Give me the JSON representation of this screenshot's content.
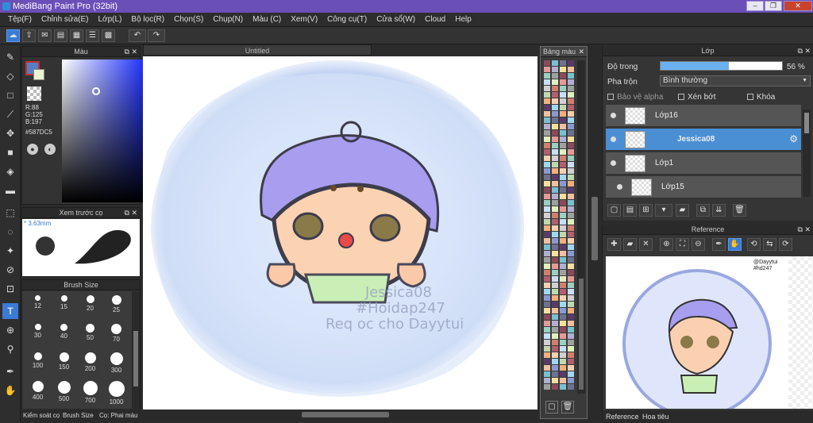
{
  "window": {
    "title": "MediBang Paint Pro (32bit)"
  },
  "menu": [
    "Tệp(F)",
    "Chỉnh sửa(E)",
    "Lớp(L)",
    "Bộ lọc(R)",
    "Chọn(S)",
    "Chụp(N)",
    "Màu (C)",
    "Xem(V)",
    "Công cụ(T)",
    "Cửa sổ(W)",
    "Cloud",
    "Help"
  ],
  "color_panel": {
    "title": "Màu",
    "r": "R:88",
    "g": "G:125",
    "b": "B:197",
    "hex": "#587DC5",
    "color": "#587dc5"
  },
  "preview_panel": {
    "title": "Xem trước cọ",
    "size": "3.63mm"
  },
  "brush_size_panel": {
    "title": "Brush Size",
    "sizes": [
      "12",
      "15",
      "20",
      "25",
      "30",
      "40",
      "50",
      "70",
      "100",
      "150",
      "200",
      "300",
      "400",
      "500",
      "700",
      "1000"
    ]
  },
  "bottom_tabs": {
    "a": "Kiểm soát cọ",
    "b": "Brush Size",
    "c": "Cọ: Phai màu"
  },
  "canvas": {
    "tab": "Untitled",
    "watermark_line1": "Jessica08",
    "watermark_line2": "#Hoidap247",
    "watermark_line3": "Req oc cho Dayytui"
  },
  "swatch_panel": {
    "title": "Bảng màu"
  },
  "layer_panel": {
    "title": "Lớp",
    "opacity_label": "Độ trong",
    "opacity_value": "56 %",
    "opacity_fraction": 0.56,
    "blend_label": "Pha trộn",
    "blend_value": "Bình thường",
    "protect_alpha": "Bảo vệ alpha",
    "clipping": "Xén bớt",
    "lock": "Khóa",
    "layers": [
      {
        "name": "Lớp16",
        "selected": false
      },
      {
        "name": "Jessica08",
        "selected": true
      },
      {
        "name": "Lớp1",
        "selected": false
      },
      {
        "name": "Lớp15",
        "selected": false
      }
    ]
  },
  "reference_panel": {
    "title": "Reference",
    "note1": "@Dayytui",
    "note2": "#hd247",
    "tab_a": "Reference",
    "tab_b": "Hoa tiêu"
  }
}
